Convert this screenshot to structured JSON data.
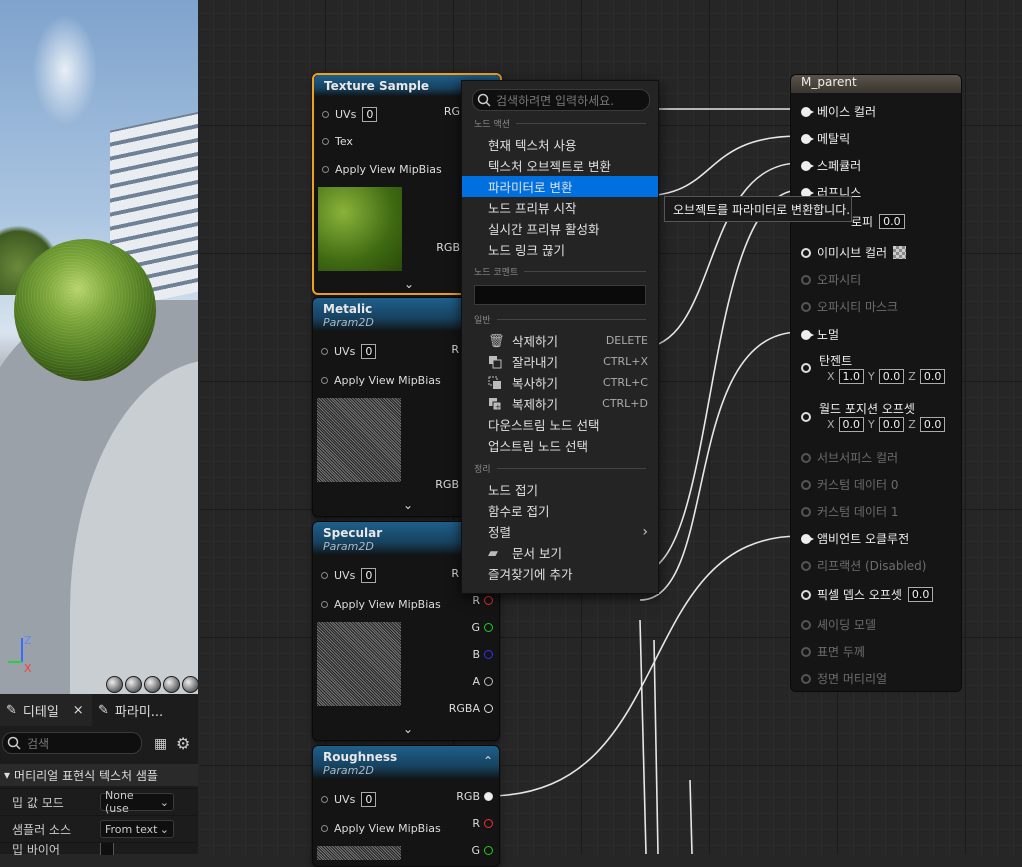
{
  "viewport": {
    "axis": {
      "z": "Z",
      "x": "X"
    }
  },
  "details": {
    "tab_details": "디테일",
    "tab_close": "×",
    "tab_params": "파라미...",
    "search_placeholder": "검색",
    "section_header": "머티리얼 표현식 텍스처 샘플",
    "rows": [
      {
        "label": "밉 값 모드",
        "value": "None (use"
      },
      {
        "label": "샘플러 소스",
        "value": "From text"
      },
      {
        "label": "밉 바이어"
      }
    ]
  },
  "nodes": {
    "texture_sample": {
      "title": "Texture Sample",
      "uvs": "UVs",
      "uvs_value": "0",
      "tex": "Tex",
      "mip": "Apply View MipBias",
      "out_rgb_top": "RG",
      "out_rgb": "RGB"
    },
    "metalic": {
      "title": "Metalic",
      "subtitle": "Param2D",
      "uvs": "UVs",
      "uvs_value": "0",
      "mip": "Apply View MipBias",
      "out_top": "R",
      "out_rgb": "RGB"
    },
    "specular": {
      "title": "Specular",
      "subtitle": "Param2D",
      "uvs": "UVs",
      "uvs_value": "0",
      "mip": "Apply View MipBias",
      "out_top": "R",
      "r": "R",
      "g": "G",
      "b": "B",
      "a": "A",
      "rgba": "RGBA"
    },
    "roughness": {
      "title": "Roughness",
      "subtitle": "Param2D",
      "uvs": "UVs",
      "uvs_value": "0",
      "mip": "Apply View MipBias",
      "rgb": "RGB",
      "r": "R",
      "g": "G"
    }
  },
  "m_parent": {
    "title": "M_parent",
    "pins": [
      {
        "label": "베이스 컬러",
        "state": "connected"
      },
      {
        "label": "메탈릭",
        "state": "connected"
      },
      {
        "label": "스페큘러",
        "state": "connected"
      },
      {
        "label": "러프니스",
        "state": "connected"
      },
      {
        "label": "로피",
        "value": "0.0",
        "state": "open"
      },
      {
        "label": "이미시브 컬러",
        "state": "open"
      },
      {
        "label": "오파시티",
        "state": "disabled"
      },
      {
        "label": "오파시티 마스크",
        "state": "disabled"
      },
      {
        "label": "노멀",
        "state": "connected"
      },
      {
        "label": "탄젠트",
        "state": "open"
      },
      {
        "label": "월드 포지션 오프셋",
        "state": "open"
      },
      {
        "label": "서브서피스 컬러",
        "state": "disabled"
      },
      {
        "label": "커스텀 데이터 0",
        "state": "disabled"
      },
      {
        "label": "커스텀 데이터 1",
        "state": "disabled"
      },
      {
        "label": "앰비언트 오클루전",
        "state": "connected"
      },
      {
        "label": "리프랙션 (Disabled)",
        "state": "disabled"
      },
      {
        "label": "픽셀 뎁스 오프셋",
        "value": "0.0",
        "state": "open"
      },
      {
        "label": "셰이딩 모델",
        "state": "disabled"
      },
      {
        "label": "표면 두께",
        "state": "disabled"
      },
      {
        "label": "정면 머티리얼",
        "state": "disabled"
      }
    ],
    "tangent": {
      "x": "1.0",
      "y": "0.0",
      "z": "0.0"
    },
    "wpo": {
      "x": "0.0",
      "y": "0.0",
      "z": "0.0"
    },
    "axis_labels": {
      "x": "X",
      "y": "Y",
      "z": "Z"
    }
  },
  "menu": {
    "search_placeholder": "검색하려면 입력하세요.",
    "section_node_actions": "노드 액션",
    "section_node_comment": "노드 코멘트",
    "section_general": "일반",
    "section_organize": "정리",
    "items": [
      {
        "label": "현재 텍스처 사용"
      },
      {
        "label": "텍스처 오브젝트로 변환"
      },
      {
        "label": "파라미터로 변환",
        "highlighted": true
      },
      {
        "label": "노드 프리뷰 시작"
      },
      {
        "label": "실시간 프리뷰 활성화"
      },
      {
        "label": "노드 링크 끊기"
      }
    ],
    "general_items": [
      {
        "label": "삭제하기",
        "shortcut": "DELETE",
        "icon": "trash-icon"
      },
      {
        "label": "잘라내기",
        "shortcut": "CTRL+X",
        "icon": "cut-icon"
      },
      {
        "label": "복사하기",
        "shortcut": "CTRL+C",
        "icon": "copy-icon"
      },
      {
        "label": "복제하기",
        "shortcut": "CTRL+D",
        "icon": "duplicate-icon"
      },
      {
        "label": "다운스트림 노드 선택"
      },
      {
        "label": "업스트림 노드 선택"
      }
    ],
    "organize_items": [
      {
        "label": "노드 접기"
      },
      {
        "label": "함수로 접기"
      },
      {
        "label": "정렬",
        "submenu": true
      },
      {
        "label": "문서 보기",
        "icon": "docs-icon"
      },
      {
        "label": "즐겨찾기에 추가"
      }
    ]
  },
  "tooltip": "오브젝트를 파라미터로 변환합니다."
}
